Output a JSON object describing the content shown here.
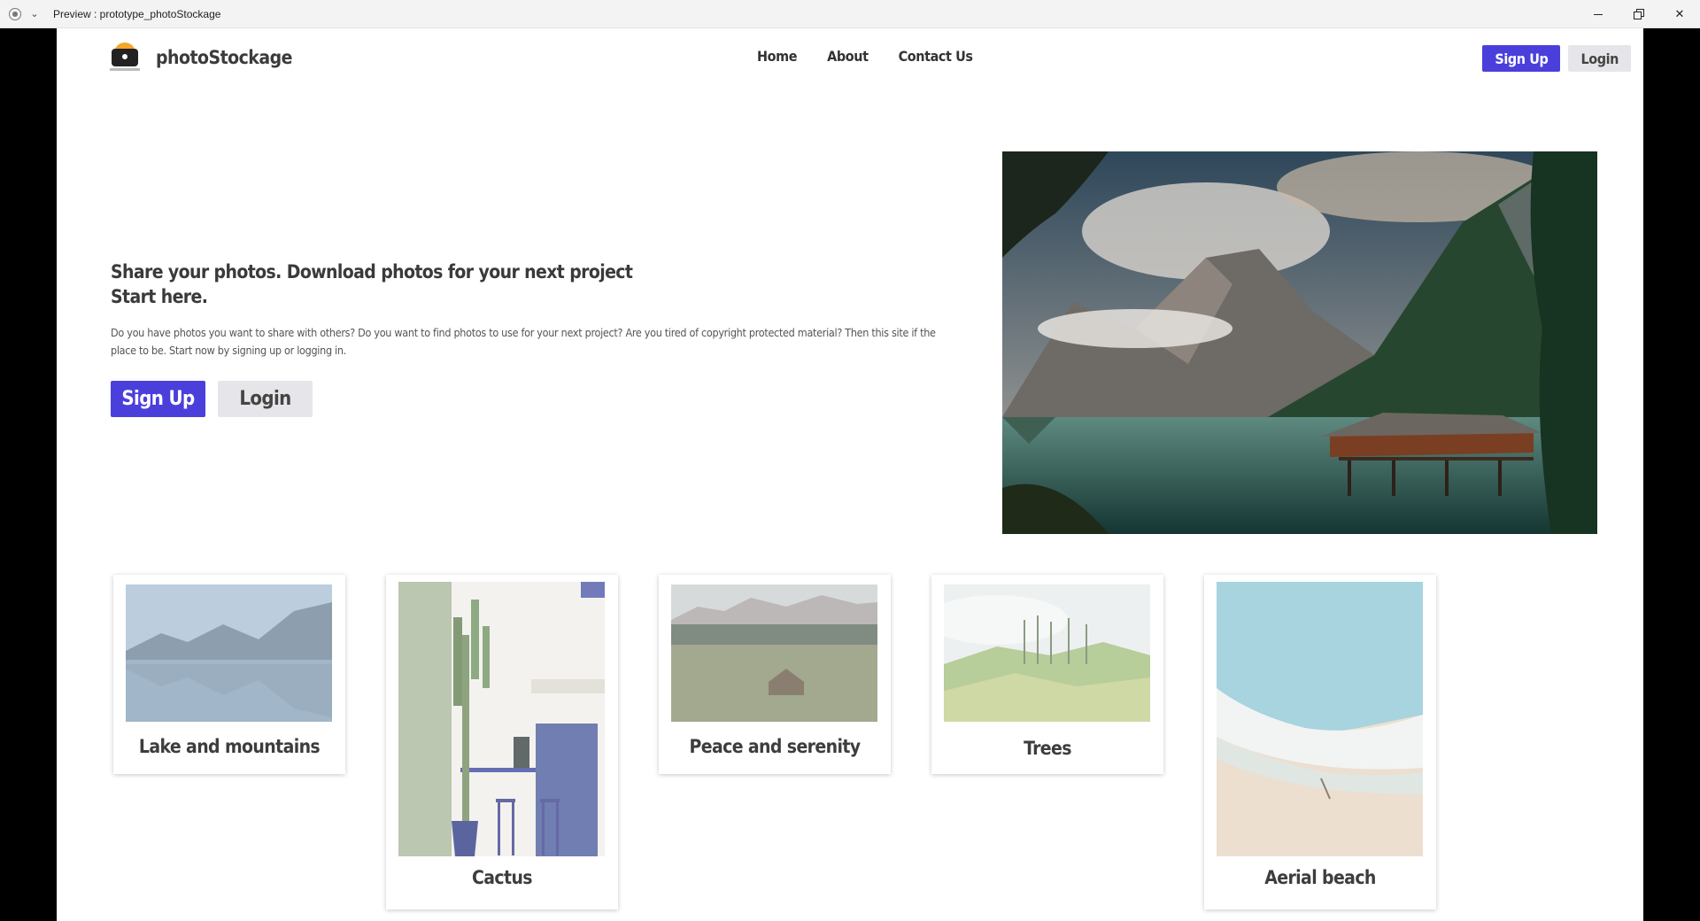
{
  "window": {
    "title": "Preview : prototype_photoStockage"
  },
  "nav": {
    "brand": "photoStockage",
    "links": [
      "Home",
      "About",
      "Contact Us"
    ],
    "signup_label": "Sign Up",
    "login_label": "Login"
  },
  "hero": {
    "heading_line1": "Share your photos. Download photos for your next project",
    "heading_line2": "Start here.",
    "description": "Do you have photos you want to share with others? Do you want to find photos to use for your next project? Are you tired of copyright protected material? Then this site if the place to be. Start now by signing up or logging in.",
    "signup_label": "Sign Up",
    "login_label": "Login"
  },
  "gallery": [
    {
      "caption": "Lake and mountains"
    },
    {
      "caption": "Cactus"
    },
    {
      "caption": "Peace and serenity"
    },
    {
      "caption": "Trees"
    },
    {
      "caption": "Aerial beach"
    }
  ],
  "colors": {
    "primary": "#4b3fdc",
    "secondary": "#e6e6ea",
    "text": "#3a3a3a"
  }
}
